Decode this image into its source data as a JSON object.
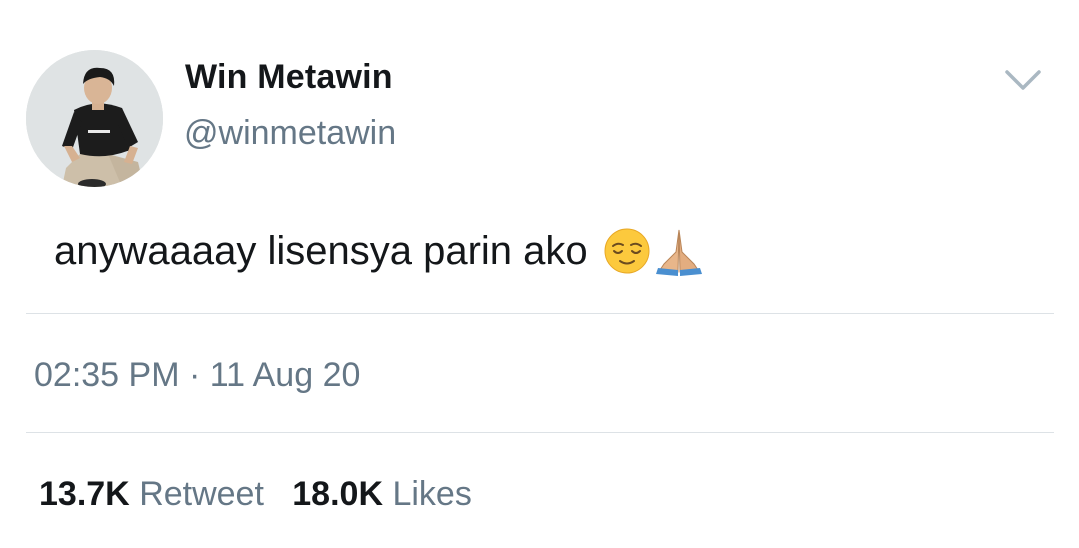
{
  "author": {
    "display_name": "Win Metawin",
    "handle": "@winmetawin",
    "avatar_icon": "profile-photo"
  },
  "tweet": {
    "text": "anywaaaay lisensya parin ako",
    "emojis": [
      "relieved-face",
      "folded-hands"
    ],
    "time": "02:35 PM",
    "separator": "·",
    "date": "11 Aug 20"
  },
  "stats": {
    "retweets_count": "13.7K",
    "retweets_label": "Retweet",
    "likes_count": "18.0K",
    "likes_label": "Likes"
  },
  "menu": {
    "icon": "chevron-down-icon"
  },
  "colors": {
    "text_primary": "#14171a",
    "text_secondary": "#657786",
    "divider": "#dde2e6",
    "background": "#ffffff"
  }
}
